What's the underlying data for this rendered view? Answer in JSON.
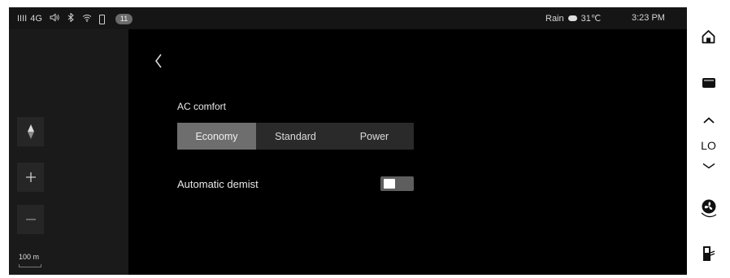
{
  "status": {
    "signal": "IIII",
    "network": "4G",
    "notification_badge": "11",
    "weather_condition": "Rain",
    "temperature": "31℃",
    "time": "3:23 PM"
  },
  "map": {
    "scale_label": "100 m"
  },
  "settings": {
    "ac_comfort_label": "AC comfort",
    "modes": [
      "Economy",
      "Standard",
      "Power"
    ],
    "selected_mode": "Economy",
    "automatic_demist_label": "Automatic demist",
    "automatic_demist_on": false
  },
  "right_rail": {
    "temperature_setting": "LO"
  }
}
